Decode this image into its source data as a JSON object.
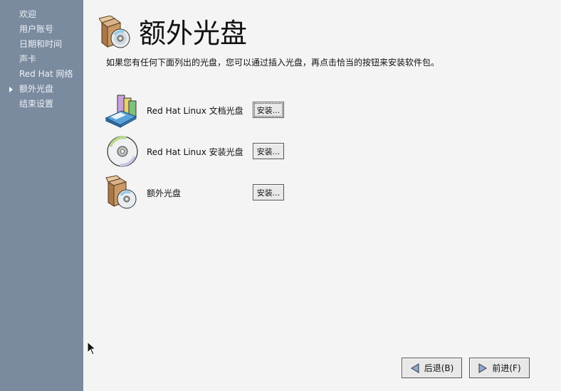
{
  "sidebar": {
    "items": [
      {
        "label": "欢迎",
        "current": false
      },
      {
        "label": "用户账号",
        "current": false
      },
      {
        "label": "日期和时间",
        "current": false
      },
      {
        "label": "声卡",
        "current": false
      },
      {
        "label": "Red  Hat  网络",
        "current": false
      },
      {
        "label": "额外光盘",
        "current": true
      },
      {
        "label": "结束设置",
        "current": false
      }
    ]
  },
  "header": {
    "title": "额外光盘",
    "icon": "box-cd-icon"
  },
  "description": "如果您有任何下面列出的光盘，您可以通过插入光盘，再点击恰当的按钮来安装软件包。",
  "discs": [
    {
      "label": "Red  Hat  Linux  文档光盘",
      "button": "安装...",
      "icon": "books-icon"
    },
    {
      "label": "Red  Hat  Linux  安装光盘",
      "button": "安装...",
      "icon": "cd-icon"
    },
    {
      "label": "额外光盘",
      "button": "安装...",
      "icon": "box-cd-icon"
    }
  ],
  "footer": {
    "back_label": "后退(B)",
    "next_label": "前进(F)"
  },
  "colors": {
    "sidebar_bg": "#7a8a9f",
    "main_bg": "#f4f4f4"
  }
}
